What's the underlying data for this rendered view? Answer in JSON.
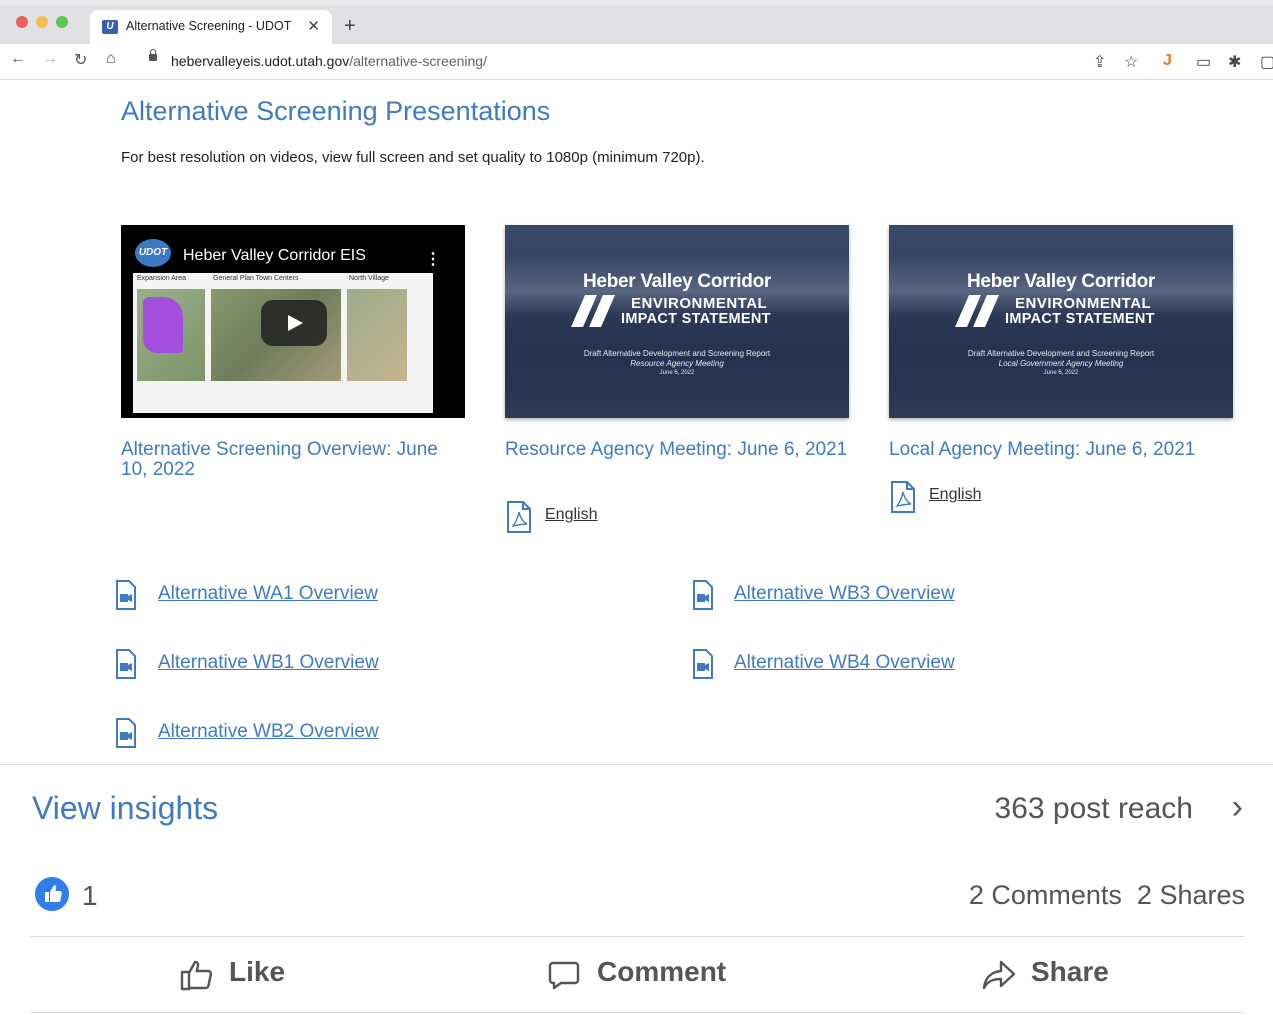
{
  "browser": {
    "tab_title": "Alternative Screening - UDOT",
    "favicon_text": "U",
    "url_host": "hebervalleyeis.udot.utah.gov",
    "url_path": "/alternative-screening/"
  },
  "page": {
    "heading": "Alternative Screening Presentations",
    "note": "For best resolution on videos, view full screen and set quality to 1080p (minimum 720p).",
    "cards": [
      {
        "title": "Alternative Screening Overview: June 10, 2022",
        "video_channel": "UDOT",
        "video_title": "Heber Valley Corridor EIS",
        "video_labels": [
          "Expansion Area",
          "General Plan Town Centers",
          "North Village"
        ]
      },
      {
        "title": "Resource Agency Meeting: June 6, 2021",
        "slide_title": "Heber Valley Corridor",
        "slide_env": "ENVIRONMENTAL",
        "slide_impact": "IMPACT STATEMENT",
        "slide_sub": "Draft Alternative Development and Screening Report",
        "slide_meeting": "Resource Agency Meeting",
        "slide_date": "June 6, 2022",
        "link": "English"
      },
      {
        "title": "Local Agency Meeting: June 6, 2021",
        "slide_title": "Heber Valley Corridor",
        "slide_env": "ENVIRONMENTAL",
        "slide_impact": "IMPACT STATEMENT",
        "slide_sub": "Draft Alternative Development and Screening Report",
        "slide_meeting": "Local Government Agency Meeting",
        "slide_date": "June 6, 2022",
        "link": "English"
      }
    ],
    "video_links": {
      "wa1": "Alternative WA1 Overview",
      "wb3": "Alternative WB3 Overview",
      "wb1": "Alternative WB1 Overview",
      "wb4": "Alternative WB4 Overview",
      "wb2": "Alternative WB2 Overview"
    }
  },
  "facebook": {
    "insights": "View insights",
    "reach": "363 post reach",
    "likes": "1",
    "comments": "2 Comments",
    "shares": "2 Shares",
    "actions": {
      "like": "Like",
      "comment": "Comment",
      "share": "Share"
    }
  },
  "colors": {
    "link_blue": "#3f7bc3",
    "fb_blue": "#2f7ee9"
  }
}
